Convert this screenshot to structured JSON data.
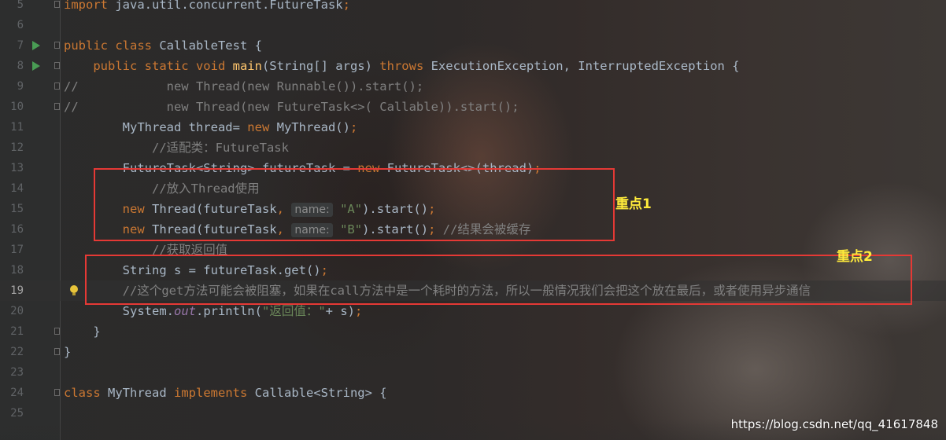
{
  "editor": {
    "language": "java",
    "current_line": "19",
    "lines": [
      {
        "n": "5",
        "tokens": [
          {
            "t": "import",
            "c": "kw"
          },
          {
            "t": " java.util.concurrent.FutureTask",
            "c": "pl"
          },
          {
            "t": ";",
            "c": "kw"
          }
        ]
      },
      {
        "n": "6",
        "tokens": []
      },
      {
        "n": "7",
        "tokens": [
          {
            "t": "public class",
            "c": "kw"
          },
          {
            "t": " CallableTest {",
            "c": "pl"
          }
        ]
      },
      {
        "n": "8",
        "tokens": [
          {
            "t": "    public static void ",
            "c": "kw"
          },
          {
            "t": "main",
            "c": "fn"
          },
          {
            "t": "(String[] args) ",
            "c": "pl"
          },
          {
            "t": "throws",
            "c": "kw"
          },
          {
            "t": " ExecutionException, InterruptedException {",
            "c": "pl"
          }
        ]
      },
      {
        "n": "9",
        "tokens": [
          {
            "t": "//            new Thread(new Runnable()).start();",
            "c": "cm"
          }
        ]
      },
      {
        "n": "10",
        "tokens": [
          {
            "t": "//            new Thread(new FutureTask<>( Callable)).start();",
            "c": "cm"
          }
        ]
      },
      {
        "n": "11",
        "tokens": [
          {
            "t": "        MyThread thread= ",
            "c": "pl"
          },
          {
            "t": "new",
            "c": "kw"
          },
          {
            "t": " MyThread()",
            "c": "pl"
          },
          {
            "t": ";",
            "c": "kw"
          }
        ]
      },
      {
        "n": "12",
        "tokens": [
          {
            "t": "            //适配类：FutureTask",
            "c": "cm"
          }
        ]
      },
      {
        "n": "13",
        "tokens": [
          {
            "t": "        FutureTask<String> futureTask = ",
            "c": "pl"
          },
          {
            "t": "new",
            "c": "kw"
          },
          {
            "t": " FutureTask<>(thread)",
            "c": "pl"
          },
          {
            "t": ";",
            "c": "kw"
          }
        ]
      },
      {
        "n": "14",
        "tokens": [
          {
            "t": "            //放入Thread使用",
            "c": "cm"
          }
        ]
      },
      {
        "n": "15",
        "tokens": [
          {
            "t": "        new",
            "c": "kw"
          },
          {
            "t": " Thread(futureTask",
            "c": "pl"
          },
          {
            "t": ",",
            "c": "kw"
          },
          {
            "t": " ",
            "c": "pl"
          },
          {
            "t": "name:",
            "c": "hint"
          },
          {
            "t": " ",
            "c": "pl"
          },
          {
            "t": "\"A\"",
            "c": "st"
          },
          {
            "t": ").start()",
            "c": "pl"
          },
          {
            "t": ";",
            "c": "kw"
          }
        ]
      },
      {
        "n": "16",
        "tokens": [
          {
            "t": "        new",
            "c": "kw"
          },
          {
            "t": " Thread(futureTask",
            "c": "pl"
          },
          {
            "t": ",",
            "c": "kw"
          },
          {
            "t": " ",
            "c": "pl"
          },
          {
            "t": "name:",
            "c": "hint"
          },
          {
            "t": " ",
            "c": "pl"
          },
          {
            "t": "\"B\"",
            "c": "st"
          },
          {
            "t": ").start()",
            "c": "pl"
          },
          {
            "t": ";",
            "c": "kw"
          },
          {
            "t": " //结果会被缓存",
            "c": "cm"
          }
        ]
      },
      {
        "n": "17",
        "tokens": [
          {
            "t": "            //获取返回值",
            "c": "cm"
          }
        ]
      },
      {
        "n": "18",
        "tokens": [
          {
            "t": "        String s = futureTask.get()",
            "c": "pl"
          },
          {
            "t": ";",
            "c": "kw"
          }
        ]
      },
      {
        "n": "19",
        "tokens": [
          {
            "t": "        //这个get方法可能会被阻塞，如果在call方法中是一个耗时的方法，所以一般情况我们会把这个放在最后，或者使用异步通信",
            "c": "cm"
          }
        ]
      },
      {
        "n": "20",
        "tokens": [
          {
            "t": "        System.",
            "c": "pl"
          },
          {
            "t": "out",
            "c": "fld"
          },
          {
            "t": ".println(",
            "c": "pl"
          },
          {
            "t": "\"返回值：\"",
            "c": "st"
          },
          {
            "t": "+ s)",
            "c": "pl"
          },
          {
            "t": ";",
            "c": "kw"
          }
        ]
      },
      {
        "n": "21",
        "tokens": [
          {
            "t": "    }",
            "c": "pl"
          }
        ]
      },
      {
        "n": "22",
        "tokens": [
          {
            "t": "}",
            "c": "pl"
          }
        ]
      },
      {
        "n": "23",
        "tokens": []
      },
      {
        "n": "24",
        "tokens": [
          {
            "t": "class",
            "c": "kw"
          },
          {
            "t": " MyThread ",
            "c": "pl"
          },
          {
            "t": "implements",
            "c": "kw"
          },
          {
            "t": " Callable<String> {",
            "c": "pl"
          }
        ]
      },
      {
        "n": "25",
        "tokens": []
      }
    ]
  },
  "annotations": {
    "note1": "重点1",
    "note2": "重点2"
  },
  "watermark": "https://blog.csdn.net/qq_41617848",
  "colors": {
    "keyword": "#cc7832",
    "comment": "#808080",
    "string": "#6a8759",
    "method": "#ffc66d",
    "field": "#9876aa",
    "plain": "#a9b7c6",
    "highlight_box": "#e53935",
    "note": "#ffeb3b"
  }
}
